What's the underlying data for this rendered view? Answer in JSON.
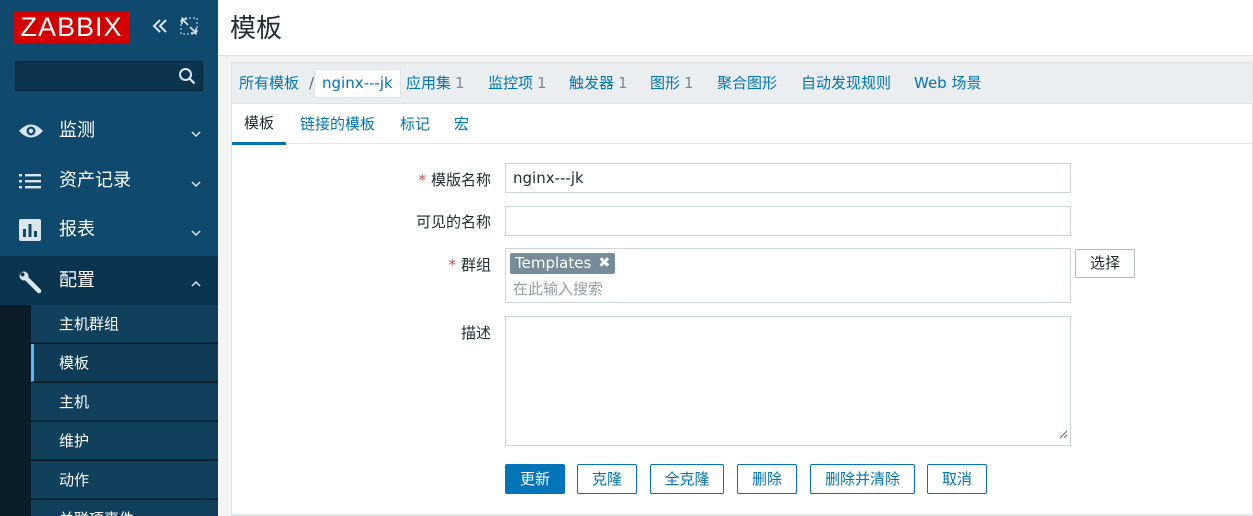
{
  "sidebar": {
    "logo": "ZABBIX",
    "search_value": "",
    "menu": [
      {
        "label": "监测",
        "icon": "eye-icon"
      },
      {
        "label": "资产记录",
        "icon": "list-icon"
      },
      {
        "label": "报表",
        "icon": "bar-chart-icon"
      },
      {
        "label": "配置",
        "icon": "wrench-icon"
      }
    ],
    "submenu": [
      {
        "label": "主机群组"
      },
      {
        "label": "模板"
      },
      {
        "label": "主机"
      },
      {
        "label": "维护"
      },
      {
        "label": "动作"
      },
      {
        "label": "关联项事件"
      }
    ]
  },
  "header": {
    "title": "模板"
  },
  "breadcrumb": {
    "all_templates": "所有模板",
    "separator": "/",
    "current": "nginx---jk",
    "links": [
      {
        "label": "应用集",
        "count": "1"
      },
      {
        "label": "监控项",
        "count": "1"
      },
      {
        "label": "触发器",
        "count": "1"
      },
      {
        "label": "图形",
        "count": "1"
      },
      {
        "label": "聚合图形",
        "count": ""
      },
      {
        "label": "自动发现规则",
        "count": ""
      },
      {
        "label": "Web 场景",
        "count": ""
      }
    ]
  },
  "tabs": [
    {
      "label": "模板"
    },
    {
      "label": "链接的模板"
    },
    {
      "label": "标记"
    },
    {
      "label": "宏"
    }
  ],
  "form": {
    "template_name_label": "模版名称",
    "template_name_value": "nginx---jk",
    "visible_name_label": "可见的名称",
    "visible_name_value": "",
    "groups_label": "群组",
    "group_chip": "Templates",
    "group_remove": "✖",
    "groups_placeholder": "在此输入搜索",
    "select_button": "选择",
    "description_label": "描述",
    "description_value": "",
    "required_mark": "*"
  },
  "buttons": {
    "update": "更新",
    "clone": "克隆",
    "full_clone": "全克隆",
    "delete": "删除",
    "delete_clear": "删除并清除",
    "cancel": "取消"
  },
  "colors": {
    "sidebar": "#0f4a6e",
    "logo": "#d40000",
    "link": "#0275b8",
    "required": "#d64e4e",
    "chip": "#768d99"
  }
}
